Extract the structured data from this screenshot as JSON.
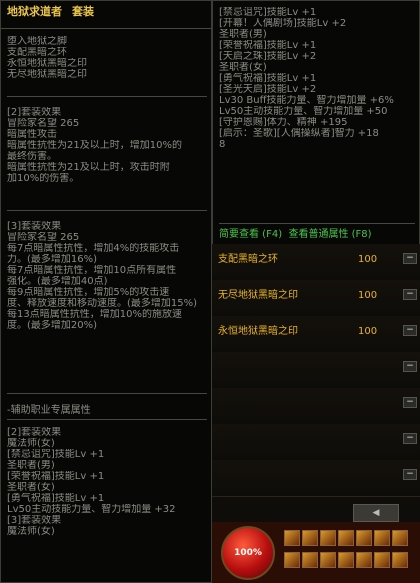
{
  "left_panel": {
    "title": "地狱求道者",
    "title_suffix": "套装",
    "set_items": [
      "堕入地狱之脚",
      "支配黑暗之环",
      "永恒地狱黑暗之印",
      "无尽地狱黑暗之印"
    ],
    "set2": [
      "[2]套装效果",
      "冒险家名望 265",
      "暗属性攻击",
      "暗属性抗性为21及以上时，增加10%的",
      "最终伤害。",
      "",
      "暗属性抗性为21及以上时，攻击时附",
      "加10%的伤害。"
    ],
    "set3": [
      "[3]套装效果",
      "冒险家名望 265",
      "每7点暗属性抗性，增加4%的技能攻击",
      "力。(最多增加16%)",
      "",
      "每7点暗属性抗性，增加10点所有属性",
      "强化。(最多增加40点)",
      "",
      "每9点暗属性抗性，增加5%的攻击速",
      "度、释放速度和移动速度。(最多增加15%)",
      "每13点暗属性抗性，增加10%的施放速",
      "度。(最多增加20%)"
    ],
    "aux_title": "-辅助职业专属属性",
    "aux2": [
      "[2]套装效果",
      "魔法师(女)",
      "[禁忌诅咒]技能Lv +1",
      "圣职者(男)",
      "[荣誉祝福]技能Lv +1",
      "圣职者(女)",
      "[勇气祝福]技能Lv +1",
      "",
      "Lv50主动技能力量、智力增加量 +32",
      "",
      "[3]套装效果",
      "魔法师(女)"
    ]
  },
  "right_panel": {
    "lines": [
      "[禁忌诅咒]技能Lv +1",
      "[开幕！人偶剧场]技能Lv +2",
      "圣职者(男)",
      "[荣誉祝福]技能Lv +1",
      "[天启之珠]技能Lv +2",
      "圣职者(女)",
      "[勇气祝福]技能Lv +1",
      "[圣光天启]技能Lv +2",
      "",
      "Lv30 Buff技能力量、智力增加量 +6%",
      "",
      "Lv50主动技能力量、智力增加量 +50",
      "",
      "[守护恩赐]体力、精神 +195",
      "[启示：圣歌][人偶操纵者]智力 +18",
      "8"
    ],
    "btn_compare": "简要查看 (F4)",
    "btn_normal": "查看普通属性 (F8)"
  },
  "equip_list": [
    {
      "name": "支配黑暗之环",
      "value": "100"
    },
    {
      "name": "无尽地狱黑暗之印",
      "value": "100"
    },
    {
      "name": "永恒地狱黑暗之印",
      "value": "100"
    }
  ],
  "minus_label": "−",
  "hud": {
    "hp": "100%"
  }
}
